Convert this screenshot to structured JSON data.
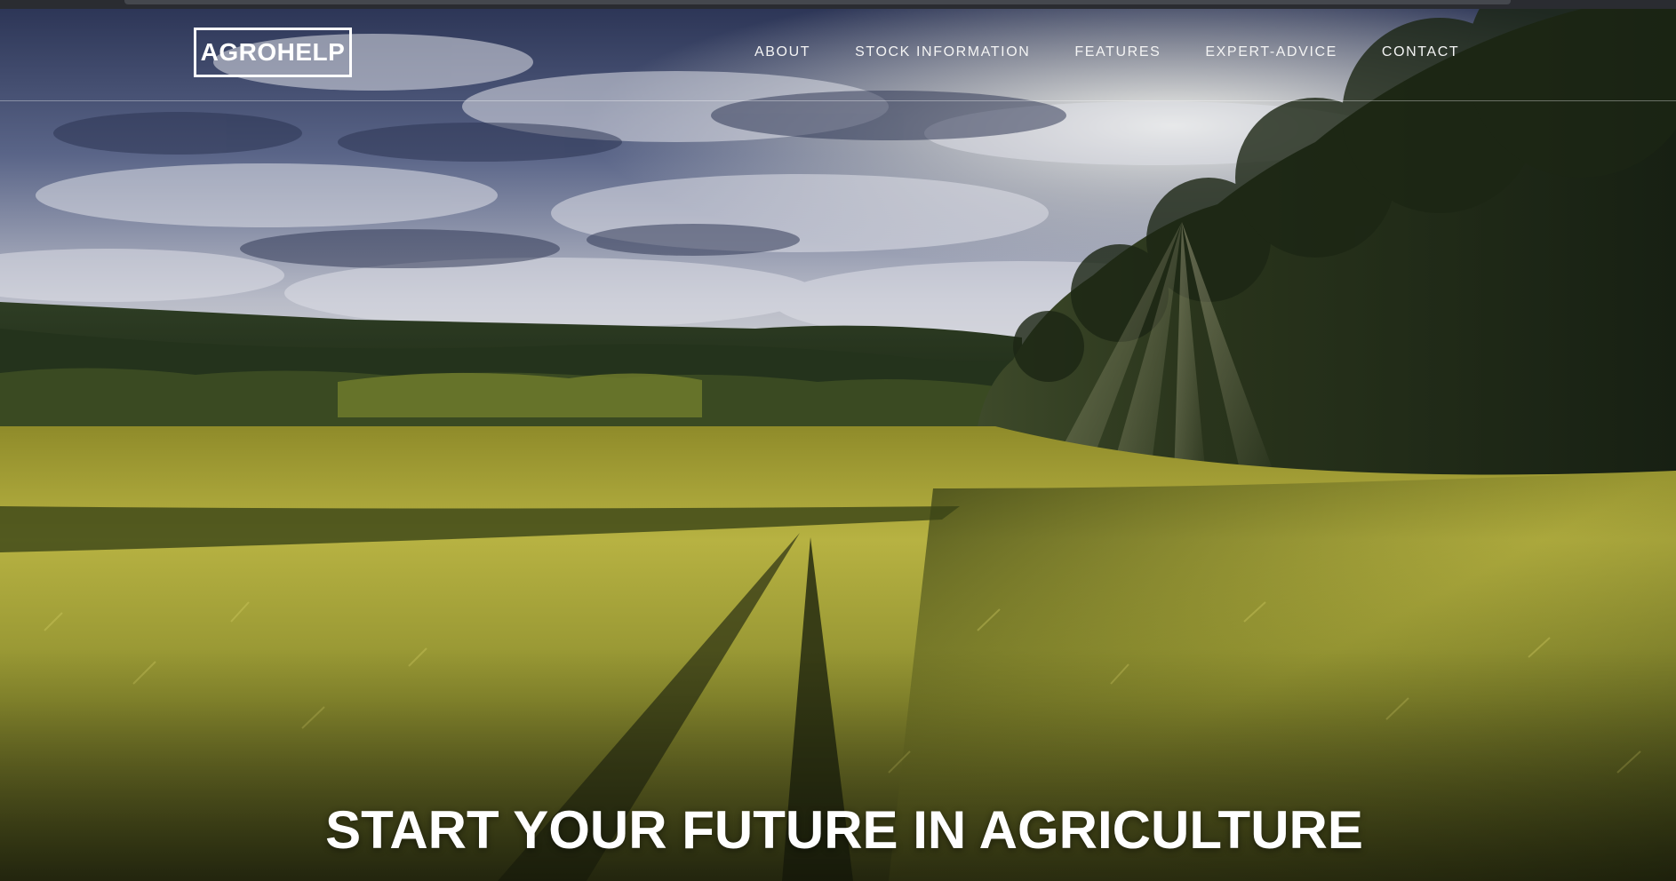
{
  "brand": {
    "logo_text": "AGROHELP"
  },
  "nav": {
    "items": [
      {
        "label": "ABOUT"
      },
      {
        "label": "STOCK INFORMATION"
      },
      {
        "label": "FEATURES"
      },
      {
        "label": "EXPERT-ADVICE"
      },
      {
        "label": "CONTACT"
      }
    ]
  },
  "hero": {
    "headline": "START YOUR FUTURE IN AGRICULTURE",
    "image": "wheat-field-landscape"
  },
  "colors": {
    "text": "#ffffff",
    "sky": "#4a5680",
    "field": "#a6a832",
    "forest": "#1e2a18"
  }
}
